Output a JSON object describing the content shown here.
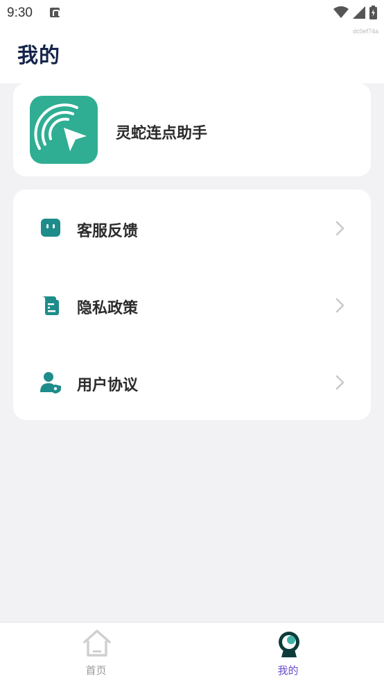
{
  "status_bar": {
    "time": "9:30",
    "build": "dc0ef74a"
  },
  "page": {
    "title": "我的"
  },
  "app_card": {
    "name": "灵蛇连点助手",
    "logo_color": "#2fae93"
  },
  "menu": {
    "items": [
      {
        "label": "客服反馈",
        "icon": "chat-icon"
      },
      {
        "label": "隐私政策",
        "icon": "scroll-icon"
      },
      {
        "label": "用户协议",
        "icon": "user-shield-icon"
      }
    ]
  },
  "tabbar": {
    "tabs": [
      {
        "label": "首页",
        "icon": "home-icon",
        "active": false
      },
      {
        "label": "我的",
        "icon": "profile-icon",
        "active": true
      }
    ],
    "active_color": "#6a4bd0",
    "inactive_color": "#9a9a9a"
  },
  "colors": {
    "brand": "#1e8c8a",
    "title": "#15254a"
  }
}
